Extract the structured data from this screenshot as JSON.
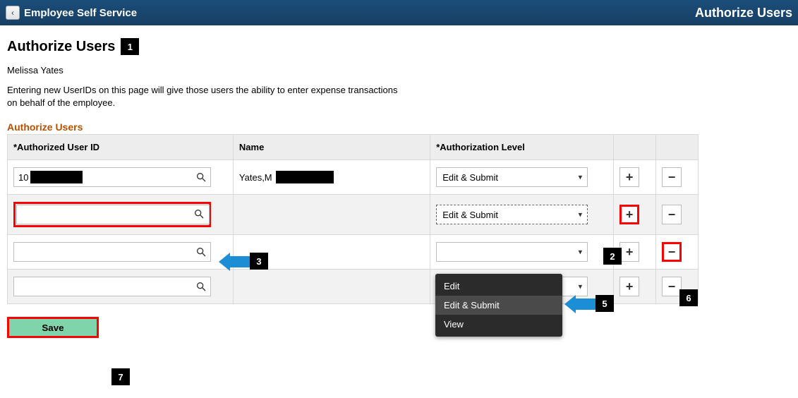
{
  "header": {
    "back_label": "<",
    "left_title": "Employee Self Service",
    "right_title": "Authorize Users"
  },
  "page": {
    "title": "Authorize Users",
    "user_name": "Melissa Yates",
    "description": "Entering new UserIDs on this page will give those users the ability to enter expense transactions on behalf of the employee.",
    "section_label": "Authorize Users"
  },
  "columns": {
    "userid": "*Authorized User ID",
    "name": "Name",
    "level": "*Authorization Level"
  },
  "rows": [
    {
      "userid": "10",
      "name": "Yates,M",
      "level": "Edit & Submit"
    },
    {
      "userid": "",
      "name": "",
      "level": "Edit & Submit"
    },
    {
      "userid": "",
      "name": "",
      "level": ""
    },
    {
      "userid": "",
      "name": "",
      "level": ""
    }
  ],
  "dropdown": {
    "opt1": "Edit",
    "opt2": "Edit & Submit",
    "opt3": "View"
  },
  "buttons": {
    "add": "+",
    "remove": "−",
    "save": "Save"
  },
  "callouts": {
    "c1": "1",
    "c2": "2",
    "c3": "3",
    "c5": "5",
    "c6": "6",
    "c7": "7"
  }
}
